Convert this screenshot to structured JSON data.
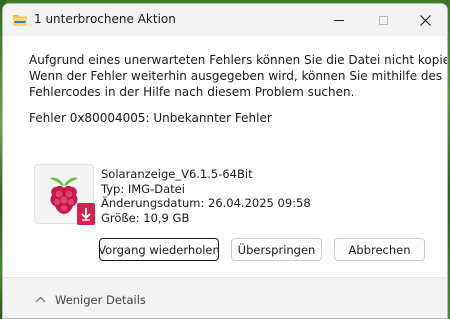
{
  "window": {
    "title": "1 unterbrochene Aktion"
  },
  "message": {
    "lines": [
      "Aufgrund eines unerwarteten Fehlers können Sie die Datei nicht kopieren.",
      "Wenn der Fehler weiterhin ausgegeben wird, können Sie mithilfe des",
      "Fehlercodes in der Hilfe nach diesem Problem suchen."
    ],
    "error": "Fehler 0x80004005: Unbekannter Fehler"
  },
  "file": {
    "name": "Solaranzeige_V6.1.5-64Bit",
    "type": "Typ: IMG-Datei",
    "modified": "Änderungsdatum: 26.04.2025 09:58",
    "size": "Größe: 10,9 GB",
    "icon": "raspberry-pi-icon"
  },
  "buttons": {
    "retry": "Vorgang wiederholen",
    "skip": "Überspringen",
    "cancel": "Abbrechen"
  },
  "footer": {
    "toggle": "Weniger Details"
  },
  "colors": {
    "badge": "#d9214f",
    "raspberry": "#c51a4a",
    "leaf": "#6cc04a"
  }
}
